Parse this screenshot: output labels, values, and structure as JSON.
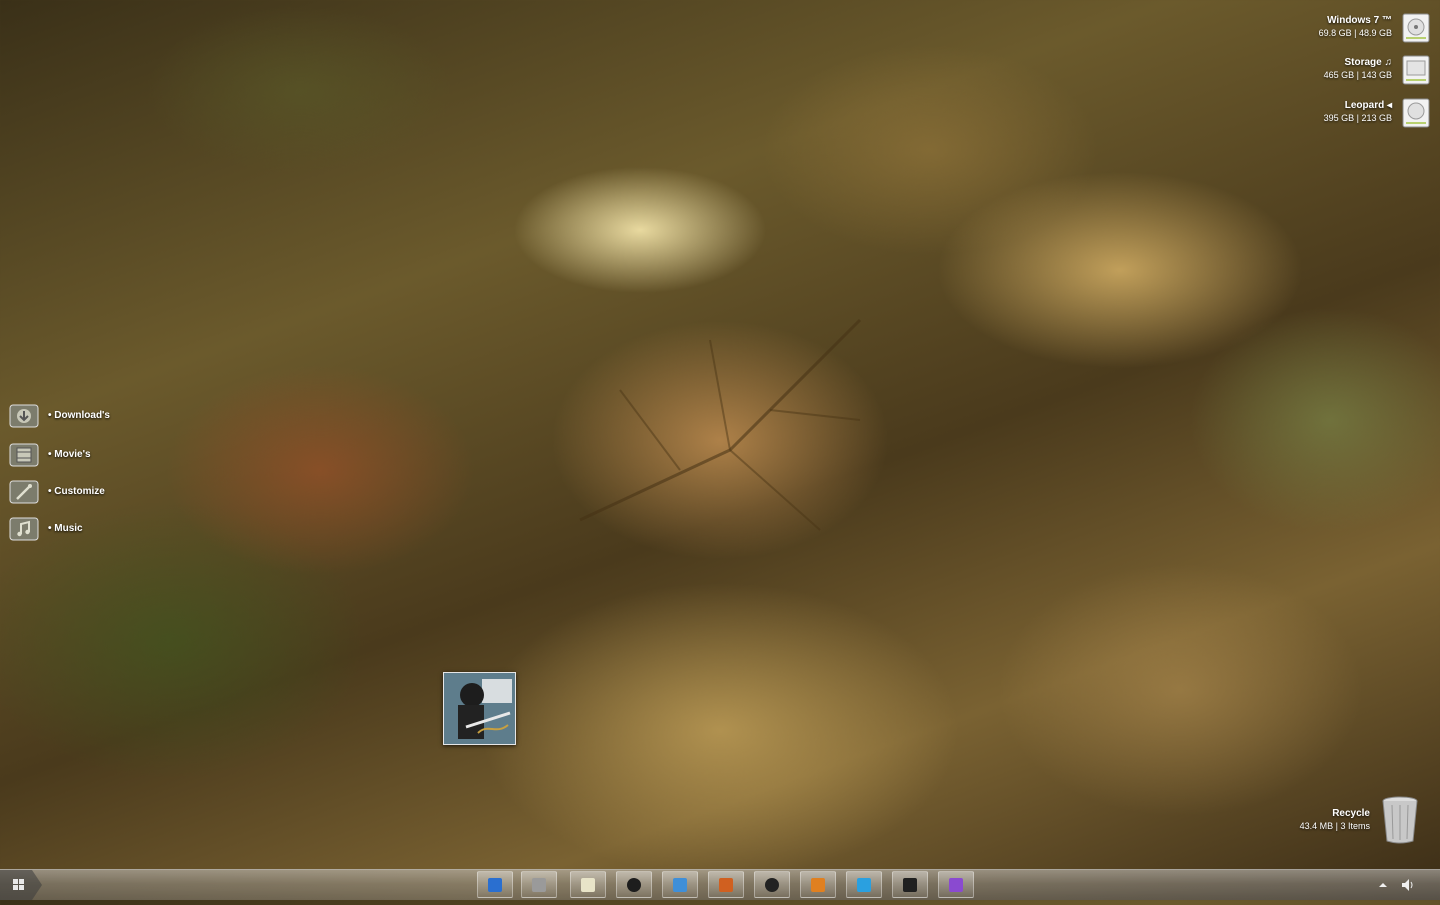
{
  "drives": [
    {
      "name": "Windows 7 ™",
      "usage": "69.8 GB | 48.9 GB",
      "icon": "hard-drive-icon"
    },
    {
      "name": "Storage ♫",
      "usage": "465 GB | 143 GB",
      "icon": "hard-drive-icon"
    },
    {
      "name": "Leopard ◂",
      "usage": "395 GB | 213 GB",
      "icon": "hard-drive-icon"
    }
  ],
  "sidebar": {
    "items": [
      {
        "label": "• Download's",
        "icon": "download-icon"
      },
      {
        "label": "• Movie's",
        "icon": "film-icon"
      },
      {
        "label": "• Customize",
        "icon": "customize-icon"
      },
      {
        "label": "• Music",
        "icon": "music-note-icon"
      }
    ]
  },
  "recycle": {
    "name": "Recycle",
    "usage": "43.4 MB | 3 Items",
    "icon": "trash-icon"
  },
  "taskbar": {
    "start_icon": "windows-logo-icon",
    "apps": [
      {
        "icon": "edit-icon",
        "color": "#2a6fd0"
      },
      {
        "icon": "bin-icon",
        "color": "#9a9a9a"
      },
      {
        "icon": "notepad-icon",
        "color": "#e8e4c8"
      },
      {
        "icon": "media-player-icon",
        "color": "#1d1d1d"
      },
      {
        "icon": "picture-icon",
        "color": "#3f8fd8"
      },
      {
        "icon": "book-icon",
        "color": "#d06020"
      },
      {
        "icon": "camera-icon",
        "color": "#222222"
      },
      {
        "icon": "fire-icon",
        "color": "#e08020"
      },
      {
        "icon": "messenger-icon",
        "color": "#2aa0e0"
      },
      {
        "icon": "calendar-icon",
        "color": "#202020"
      },
      {
        "icon": "chat-icon",
        "color": "#8a4ad0"
      }
    ],
    "tray": {
      "arrow_icon": "show-hidden-icon",
      "volume_icon": "speaker-icon"
    }
  },
  "colors": {
    "label_text": "#ffffff",
    "taskbar": "#9a9a9a"
  }
}
